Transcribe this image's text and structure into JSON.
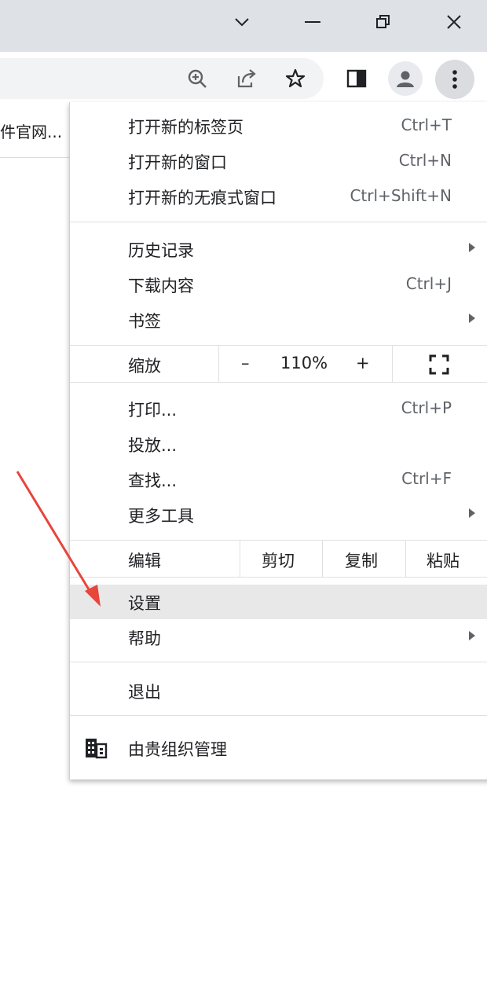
{
  "window_controls": {
    "tab_search": "chevron-down-icon",
    "minimize": "minimize-icon",
    "restore": "restore-icon",
    "close": "close-icon"
  },
  "toolbar_icons": [
    "zoom-icon",
    "share-icon",
    "bookmark-star-icon",
    "side-panel-icon",
    "profile-icon",
    "more-menu-icon"
  ],
  "bookmarks_bar": {
    "item_text": "件官网..."
  },
  "menu": {
    "new_tab": {
      "label": "打开新的标签页",
      "shortcut": "Ctrl+T"
    },
    "new_window": {
      "label": "打开新的窗口",
      "shortcut": "Ctrl+N"
    },
    "new_incognito": {
      "label": "打开新的无痕式窗口",
      "shortcut": "Ctrl+Shift+N"
    },
    "history": {
      "label": "历史记录"
    },
    "downloads": {
      "label": "下载内容",
      "shortcut": "Ctrl+J"
    },
    "bookmarks": {
      "label": "书签"
    },
    "zoom": {
      "label": "缩放",
      "minus": "–",
      "value": "110%",
      "plus": "+"
    },
    "print": {
      "label": "打印...",
      "shortcut": "Ctrl+P"
    },
    "cast": {
      "label": "投放..."
    },
    "find": {
      "label": "查找...",
      "shortcut": "Ctrl+F"
    },
    "more_tools": {
      "label": "更多工具"
    },
    "edit": {
      "label": "编辑",
      "cut": "剪切",
      "copy": "复制",
      "paste": "粘贴"
    },
    "settings": {
      "label": "设置"
    },
    "help": {
      "label": "帮助"
    },
    "exit": {
      "label": "退出"
    },
    "managed": {
      "label": "由贵组织管理"
    }
  },
  "colors": {
    "titlebar": "#dee1e6",
    "highlight": "#e8e8e8",
    "annotation_arrow": "#e8453c"
  }
}
